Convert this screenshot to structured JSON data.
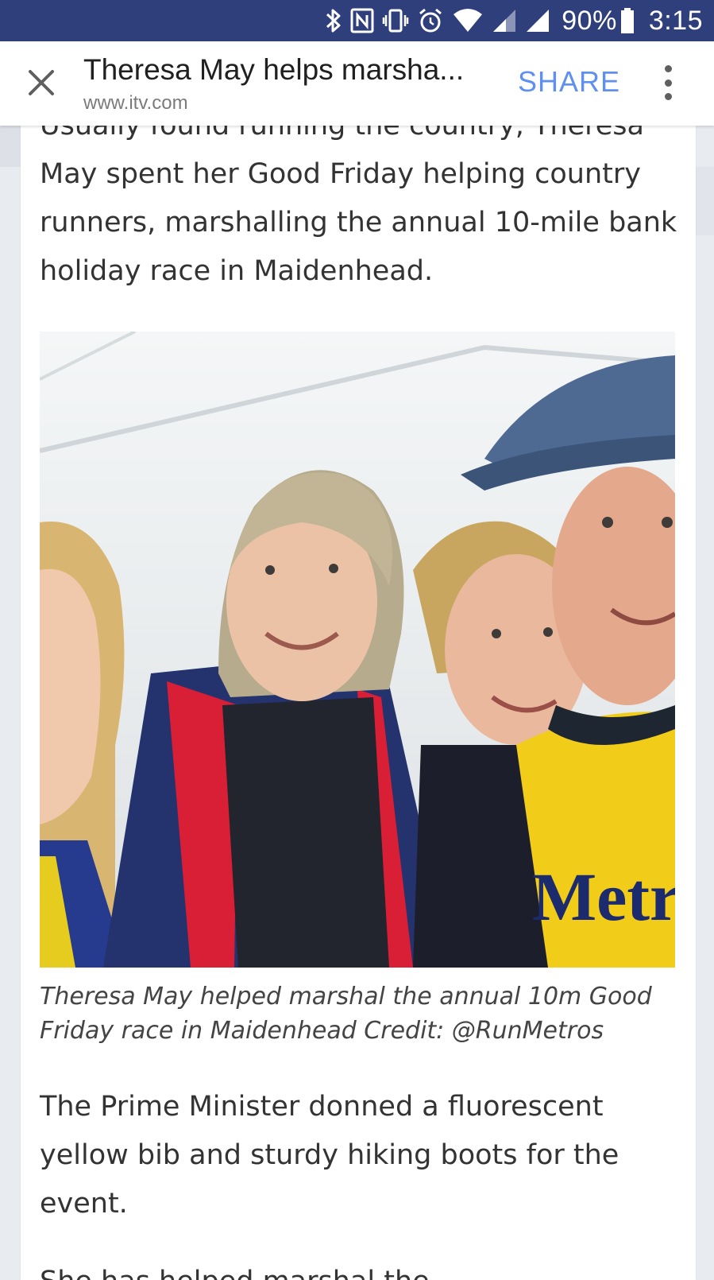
{
  "status_bar": {
    "battery_percent": "90%",
    "time": "3:15",
    "icons": [
      "bluetooth-icon",
      "nfc-icon",
      "vibrate-icon",
      "alarm-icon",
      "wifi-icon",
      "signal-icon",
      "signal-icon",
      "battery-icon"
    ]
  },
  "toolbar": {
    "close_icon": "close-icon",
    "title": "Theresa May helps marsha...",
    "domain": "www.itv.com",
    "share_label": "SHARE",
    "more_icon": "more-vert-icon"
  },
  "article": {
    "paragraph_top": "Usually found running the country, Theresa May spent her Good Friday helping country runners, marshalling the annual 10-mile bank holiday race in Maidenhead.",
    "photo": {
      "jersey_text": "Metro"
    },
    "caption": "Theresa May helped marshal the annual 10m Good Friday race in Maidenhead Credit: @RunMetros",
    "paragraph_bottom": "The Prime Minister donned a fluorescent yellow bib and sturdy hiking boots for the event.",
    "paragraph_next": "She has helped marshal the"
  },
  "colors": {
    "status_bar": "#2e3f7c",
    "share": "#5e8ff1",
    "text": "#333333"
  }
}
